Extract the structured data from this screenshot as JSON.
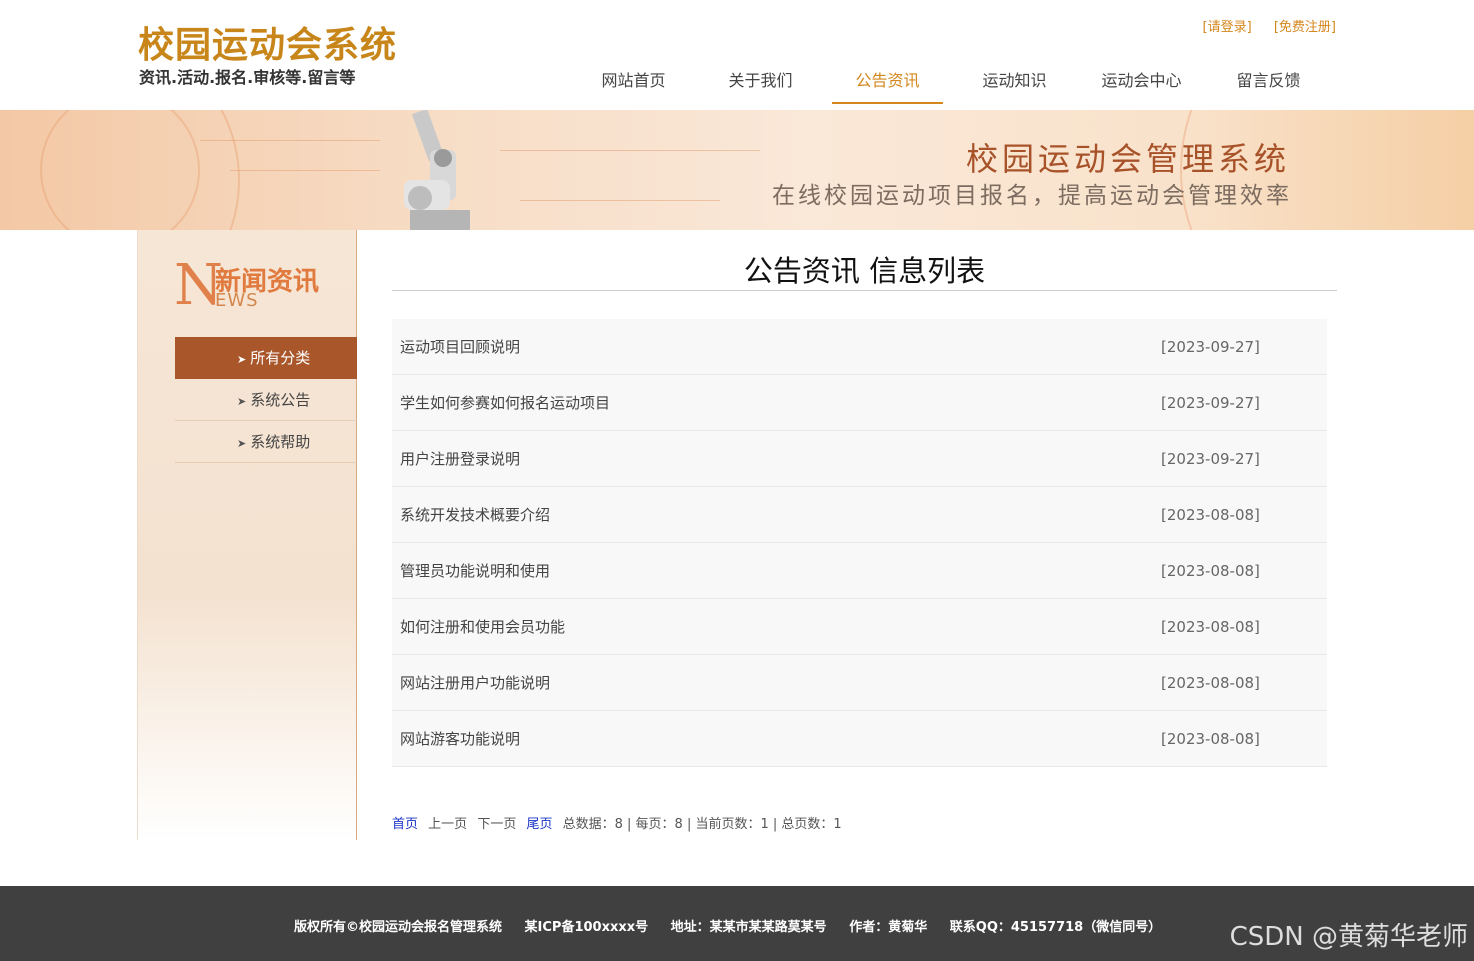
{
  "header": {
    "logo_title": "校园运动会系统",
    "logo_sub": "资讯.活动.报名.审核等.留言等",
    "login_link": "[请登录]",
    "register_link": "[免费注册]",
    "nav": [
      "网站首页",
      "关于我们",
      "公告资讯",
      "运动知识",
      "运动会中心",
      "留言反馈"
    ],
    "active_nav": "公告资讯"
  },
  "banner": {
    "title": "校园运动会管理系统",
    "subtitle": "在线校园运动项目报名，提高运动会管理效率"
  },
  "sidebar": {
    "head_letter": "N",
    "head_cn": "新闻资讯",
    "head_en": "EWS",
    "items": [
      "所有分类",
      "系统公告",
      "系统帮助"
    ],
    "active_item": "所有分类"
  },
  "main": {
    "title": "公告资讯 信息列表",
    "rows": [
      {
        "title": "运动项目回顾说明",
        "date": "[2023-09-27]"
      },
      {
        "title": "学生如何参赛如何报名运动项目",
        "date": "[2023-09-27]"
      },
      {
        "title": "用户注册登录说明",
        "date": "[2023-09-27]"
      },
      {
        "title": "系统开发技术概要介绍",
        "date": "[2023-08-08]"
      },
      {
        "title": "管理员功能说明和使用",
        "date": "[2023-08-08]"
      },
      {
        "title": "如何注册和使用会员功能",
        "date": "[2023-08-08]"
      },
      {
        "title": "网站注册用户功能说明",
        "date": "[2023-08-08]"
      },
      {
        "title": "网站游客功能说明",
        "date": "[2023-08-08]"
      }
    ]
  },
  "pager": {
    "first": "首页",
    "prev": "上一页",
    "next": "下一页",
    "last": "尾页",
    "summary": "总数据：8 | 每页：8 | 当前页数：1 | 总页数：1"
  },
  "footer": {
    "copyright": "版权所有©校园运动会报名管理系统",
    "icp": "某ICP备100xxxx号",
    "address": "地址：某某市某某路莫某号",
    "author": "作者：黄菊华",
    "qq": "联系QQ：45157718（微信同号）"
  },
  "watermark": "CSDN @黄菊华老师",
  "colors": {
    "accent": "#d4871d",
    "sidebar_active": "#a9572a",
    "footer_bg": "#404040"
  }
}
